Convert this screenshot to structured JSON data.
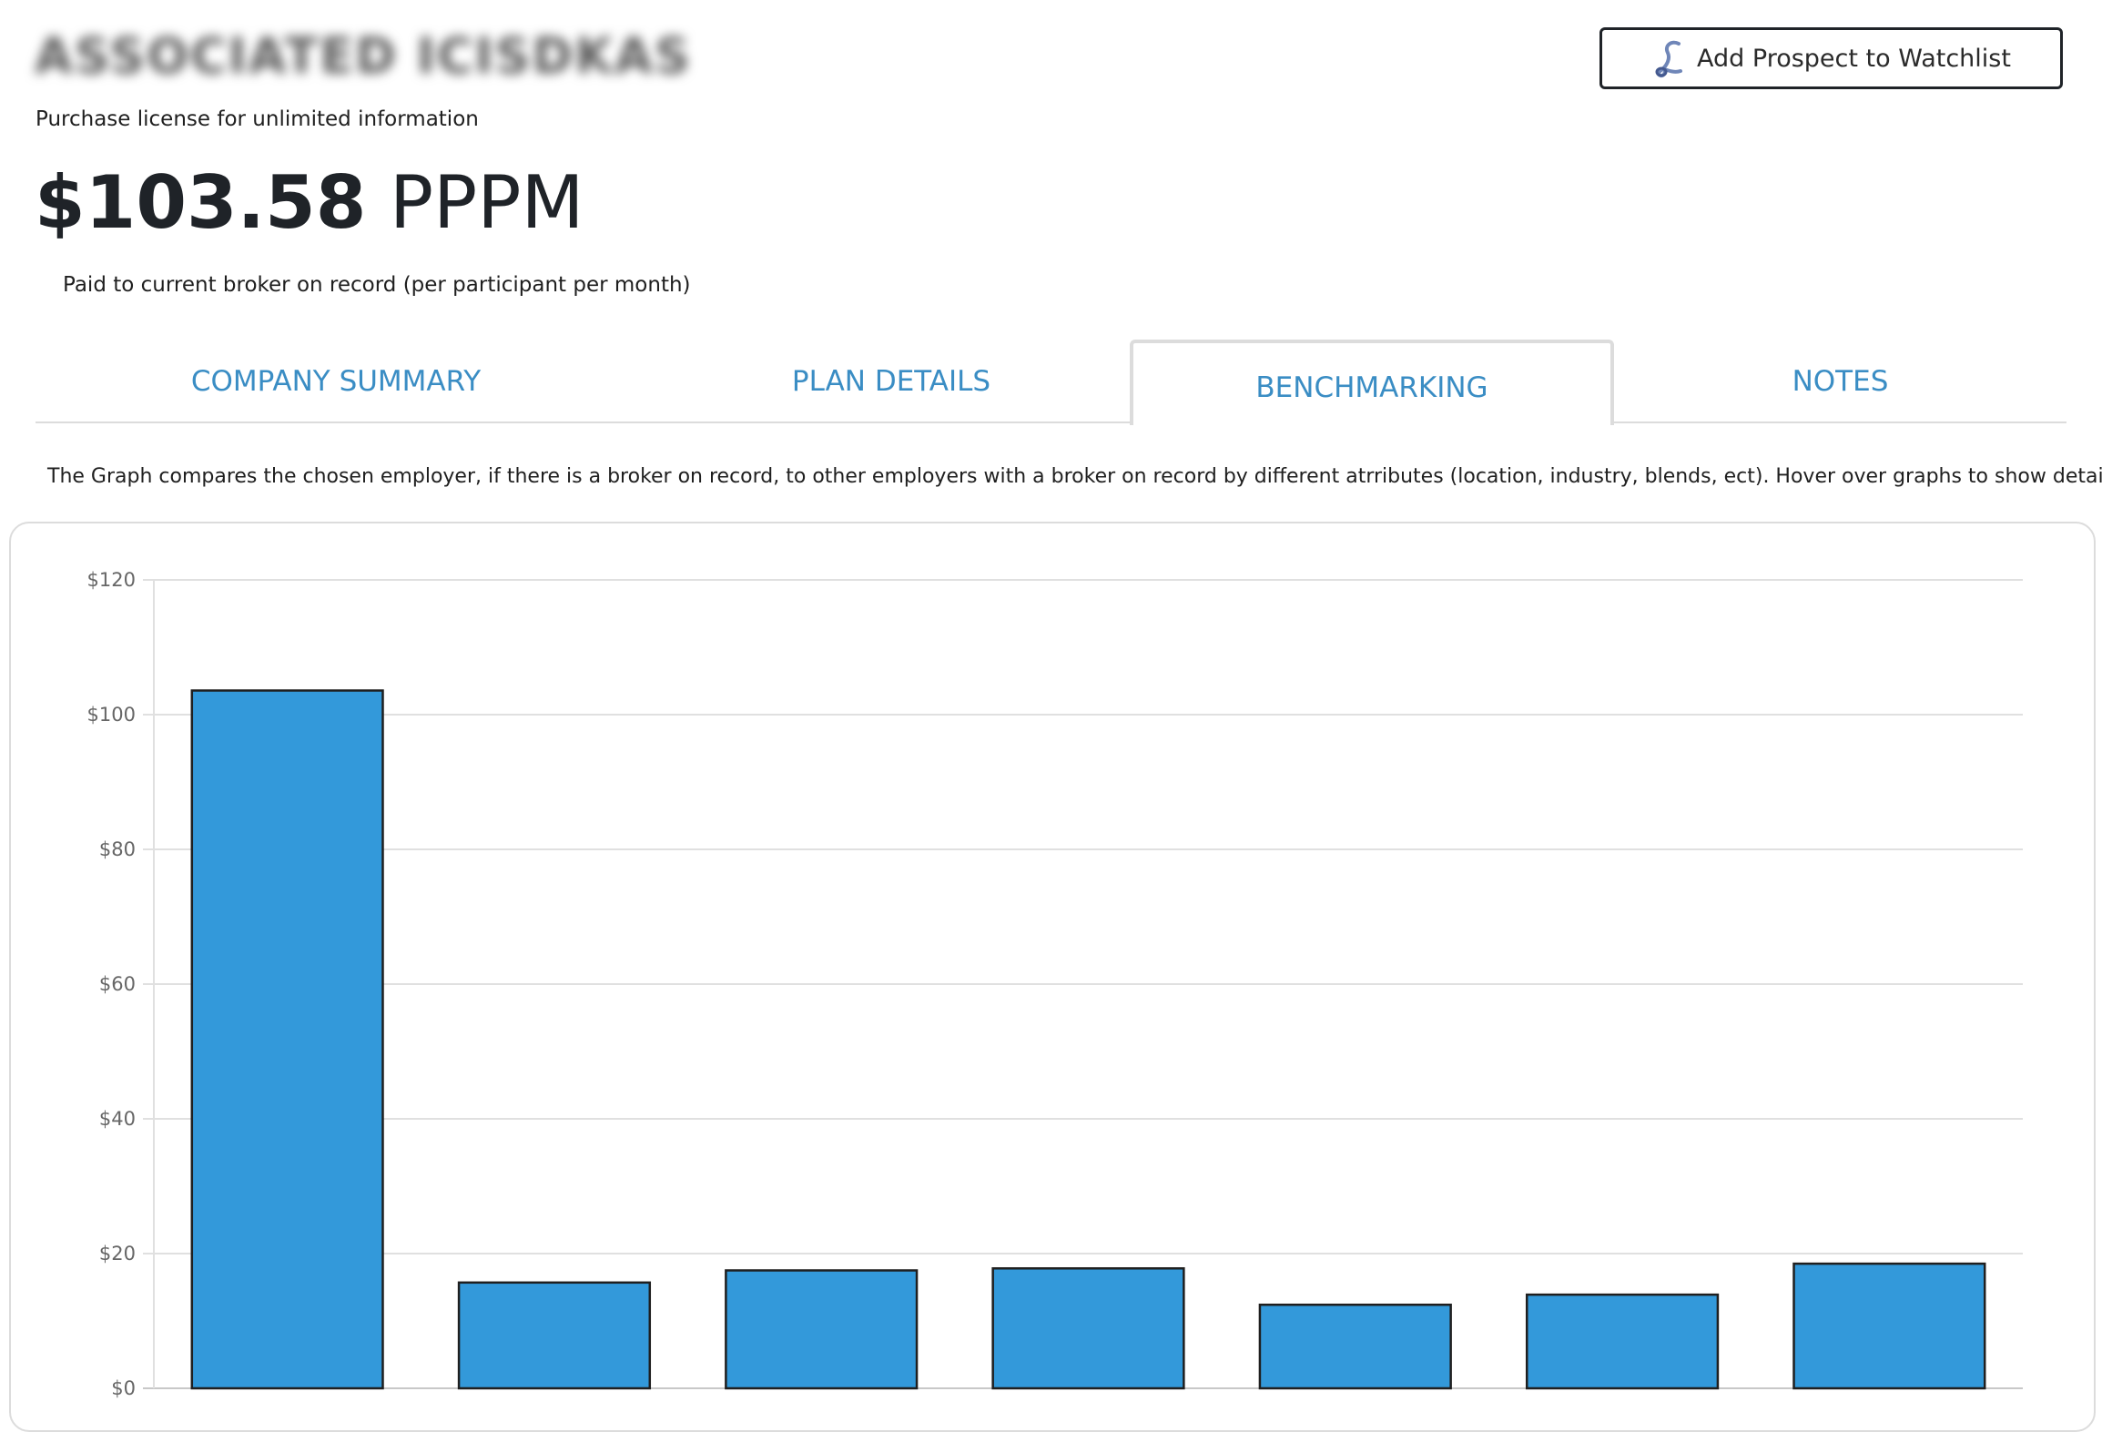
{
  "header": {
    "company_name": "ASSOCIATED ICISDKAS",
    "license_note": "Purchase license for unlimited information"
  },
  "watchlist_button": {
    "label": "Add Prospect to Watchlist",
    "icon": "lasso-icon"
  },
  "price": {
    "amount": "$103.58",
    "unit": "PPPM",
    "note": "Paid to current broker on record (per participant per month)"
  },
  "tabs": [
    {
      "label": "COMPANY SUMMARY",
      "active": false
    },
    {
      "label": "PLAN DETAILS",
      "active": false
    },
    {
      "label": "BENCHMARKING",
      "active": true
    },
    {
      "label": "NOTES",
      "active": false
    }
  ],
  "description": "The Graph compares the chosen employer, if there is a broker on record, to other employers with a broker on record by different atrributes (location, industry, blends, ect). Hover over graphs to show details",
  "colors": {
    "accent": "#3a8dc4",
    "bar_fill": "#3399da",
    "bar_stroke": "#1f1f1f",
    "grid": "#e0e0e0",
    "text_dark": "#1f2328"
  },
  "chart_data": {
    "type": "bar",
    "categories": [
      "",
      "",
      "",
      "",
      "",
      "",
      ""
    ],
    "values": [
      103.58,
      15.7,
      17.5,
      17.8,
      12.4,
      13.9,
      18.5
    ],
    "title": "",
    "xlabel": "",
    "ylabel": "",
    "ylim": [
      0,
      120
    ],
    "yticks": [
      "$0",
      "$20",
      "$40",
      "$60",
      "$80",
      "$100",
      "$120"
    ],
    "grid": true,
    "legend": "none"
  }
}
